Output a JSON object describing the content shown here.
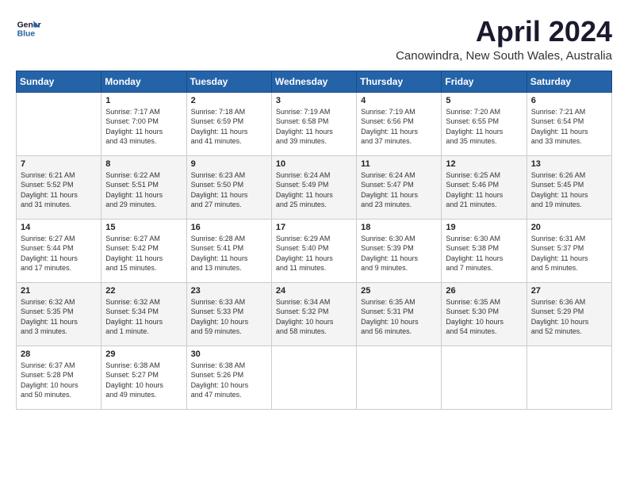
{
  "header": {
    "logo_line1": "General",
    "logo_line2": "Blue",
    "month_year": "April 2024",
    "location": "Canowindra, New South Wales, Australia"
  },
  "days_of_week": [
    "Sunday",
    "Monday",
    "Tuesday",
    "Wednesday",
    "Thursday",
    "Friday",
    "Saturday"
  ],
  "weeks": [
    [
      {
        "day": "",
        "info": ""
      },
      {
        "day": "1",
        "info": "Sunrise: 7:17 AM\nSunset: 7:00 PM\nDaylight: 11 hours\nand 43 minutes."
      },
      {
        "day": "2",
        "info": "Sunrise: 7:18 AM\nSunset: 6:59 PM\nDaylight: 11 hours\nand 41 minutes."
      },
      {
        "day": "3",
        "info": "Sunrise: 7:19 AM\nSunset: 6:58 PM\nDaylight: 11 hours\nand 39 minutes."
      },
      {
        "day": "4",
        "info": "Sunrise: 7:19 AM\nSunset: 6:56 PM\nDaylight: 11 hours\nand 37 minutes."
      },
      {
        "day": "5",
        "info": "Sunrise: 7:20 AM\nSunset: 6:55 PM\nDaylight: 11 hours\nand 35 minutes."
      },
      {
        "day": "6",
        "info": "Sunrise: 7:21 AM\nSunset: 6:54 PM\nDaylight: 11 hours\nand 33 minutes."
      }
    ],
    [
      {
        "day": "7",
        "info": "Sunrise: 6:21 AM\nSunset: 5:52 PM\nDaylight: 11 hours\nand 31 minutes."
      },
      {
        "day": "8",
        "info": "Sunrise: 6:22 AM\nSunset: 5:51 PM\nDaylight: 11 hours\nand 29 minutes."
      },
      {
        "day": "9",
        "info": "Sunrise: 6:23 AM\nSunset: 5:50 PM\nDaylight: 11 hours\nand 27 minutes."
      },
      {
        "day": "10",
        "info": "Sunrise: 6:24 AM\nSunset: 5:49 PM\nDaylight: 11 hours\nand 25 minutes."
      },
      {
        "day": "11",
        "info": "Sunrise: 6:24 AM\nSunset: 5:47 PM\nDaylight: 11 hours\nand 23 minutes."
      },
      {
        "day": "12",
        "info": "Sunrise: 6:25 AM\nSunset: 5:46 PM\nDaylight: 11 hours\nand 21 minutes."
      },
      {
        "day": "13",
        "info": "Sunrise: 6:26 AM\nSunset: 5:45 PM\nDaylight: 11 hours\nand 19 minutes."
      }
    ],
    [
      {
        "day": "14",
        "info": "Sunrise: 6:27 AM\nSunset: 5:44 PM\nDaylight: 11 hours\nand 17 minutes."
      },
      {
        "day": "15",
        "info": "Sunrise: 6:27 AM\nSunset: 5:42 PM\nDaylight: 11 hours\nand 15 minutes."
      },
      {
        "day": "16",
        "info": "Sunrise: 6:28 AM\nSunset: 5:41 PM\nDaylight: 11 hours\nand 13 minutes."
      },
      {
        "day": "17",
        "info": "Sunrise: 6:29 AM\nSunset: 5:40 PM\nDaylight: 11 hours\nand 11 minutes."
      },
      {
        "day": "18",
        "info": "Sunrise: 6:30 AM\nSunset: 5:39 PM\nDaylight: 11 hours\nand 9 minutes."
      },
      {
        "day": "19",
        "info": "Sunrise: 6:30 AM\nSunset: 5:38 PM\nDaylight: 11 hours\nand 7 minutes."
      },
      {
        "day": "20",
        "info": "Sunrise: 6:31 AM\nSunset: 5:37 PM\nDaylight: 11 hours\nand 5 minutes."
      }
    ],
    [
      {
        "day": "21",
        "info": "Sunrise: 6:32 AM\nSunset: 5:35 PM\nDaylight: 11 hours\nand 3 minutes."
      },
      {
        "day": "22",
        "info": "Sunrise: 6:32 AM\nSunset: 5:34 PM\nDaylight: 11 hours\nand 1 minute."
      },
      {
        "day": "23",
        "info": "Sunrise: 6:33 AM\nSunset: 5:33 PM\nDaylight: 10 hours\nand 59 minutes."
      },
      {
        "day": "24",
        "info": "Sunrise: 6:34 AM\nSunset: 5:32 PM\nDaylight: 10 hours\nand 58 minutes."
      },
      {
        "day": "25",
        "info": "Sunrise: 6:35 AM\nSunset: 5:31 PM\nDaylight: 10 hours\nand 56 minutes."
      },
      {
        "day": "26",
        "info": "Sunrise: 6:35 AM\nSunset: 5:30 PM\nDaylight: 10 hours\nand 54 minutes."
      },
      {
        "day": "27",
        "info": "Sunrise: 6:36 AM\nSunset: 5:29 PM\nDaylight: 10 hours\nand 52 minutes."
      }
    ],
    [
      {
        "day": "28",
        "info": "Sunrise: 6:37 AM\nSunset: 5:28 PM\nDaylight: 10 hours\nand 50 minutes."
      },
      {
        "day": "29",
        "info": "Sunrise: 6:38 AM\nSunset: 5:27 PM\nDaylight: 10 hours\nand 49 minutes."
      },
      {
        "day": "30",
        "info": "Sunrise: 6:38 AM\nSunset: 5:26 PM\nDaylight: 10 hours\nand 47 minutes."
      },
      {
        "day": "",
        "info": ""
      },
      {
        "day": "",
        "info": ""
      },
      {
        "day": "",
        "info": ""
      },
      {
        "day": "",
        "info": ""
      }
    ]
  ]
}
